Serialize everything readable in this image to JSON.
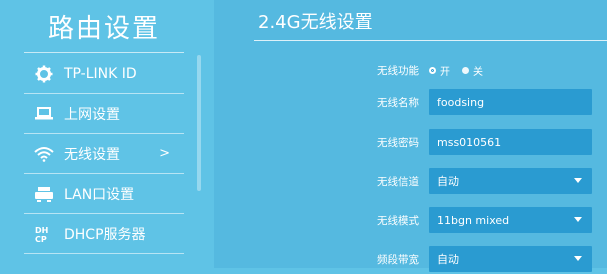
{
  "sidebar": {
    "title": "路由设置",
    "items": [
      {
        "label": "TP-LINK ID",
        "icon": "gear-icon"
      },
      {
        "label": "上网设置",
        "icon": "laptop-icon"
      },
      {
        "label": "无线设置",
        "icon": "wifi-icon",
        "chevron": ">"
      },
      {
        "label": "LAN口设置",
        "icon": "router-icon"
      },
      {
        "label": "DHCP服务器",
        "icon": "dhcp-icon"
      }
    ]
  },
  "main": {
    "title": "2.4G无线设置",
    "fields": {
      "wireless_function": {
        "label": "无线功能",
        "on": "开",
        "off": "关",
        "selected": "on"
      },
      "wireless_name": {
        "label": "无线名称",
        "value": "foodsing"
      },
      "wireless_password": {
        "label": "无线密码",
        "value": "mss010561"
      },
      "wireless_channel": {
        "label": "无线信道",
        "value": "自动"
      },
      "wireless_mode": {
        "label": "无线模式",
        "value": "11bgn mixed"
      },
      "bandwidth": {
        "label": "频段带宽",
        "value": "自动"
      }
    }
  }
}
